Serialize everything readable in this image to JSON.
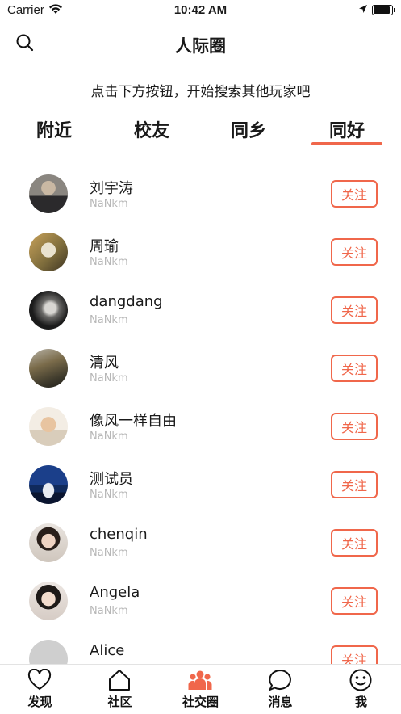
{
  "status_bar": {
    "carrier": "Carrier",
    "time": "10:42 AM"
  },
  "navbar": {
    "title": "人际圈",
    "search_icon": "search-icon"
  },
  "hint": "点击下方按钮，开始搜索其他玩家吧",
  "tabs": [
    {
      "label": "附近"
    },
    {
      "label": "校友"
    },
    {
      "label": "同乡"
    },
    {
      "label": "同好",
      "active": true
    }
  ],
  "users": [
    {
      "name": "刘宇涛",
      "sub": "NaNkm",
      "follow": "关注"
    },
    {
      "name": "周瑜",
      "sub": "NaNkm",
      "follow": "关注"
    },
    {
      "name": "dangdang",
      "sub": "NaNkm",
      "follow": "关注"
    },
    {
      "name": "清风",
      "sub": "NaNkm",
      "follow": "关注"
    },
    {
      "name": "像风一样自由",
      "sub": "NaNkm",
      "follow": "关注"
    },
    {
      "name": "测试员",
      "sub": "NaNkm",
      "follow": "关注"
    },
    {
      "name": "chenqin",
      "sub": "NaNkm",
      "follow": "关注"
    },
    {
      "name": "Angela",
      "sub": "NaNkm",
      "follow": "关注"
    },
    {
      "name": "Alice",
      "sub": "",
      "follow": "关注"
    }
  ],
  "tabbar": [
    {
      "label": "发现",
      "icon": "heart-icon"
    },
    {
      "label": "社区",
      "icon": "home-icon"
    },
    {
      "label": "社交圈",
      "icon": "people-icon",
      "active": true
    },
    {
      "label": "消息",
      "icon": "chat-bubble-icon"
    },
    {
      "label": "我",
      "icon": "smiley-icon"
    }
  ],
  "colors": {
    "accent": "#f0674b",
    "subtext": "#b7b7b7"
  }
}
